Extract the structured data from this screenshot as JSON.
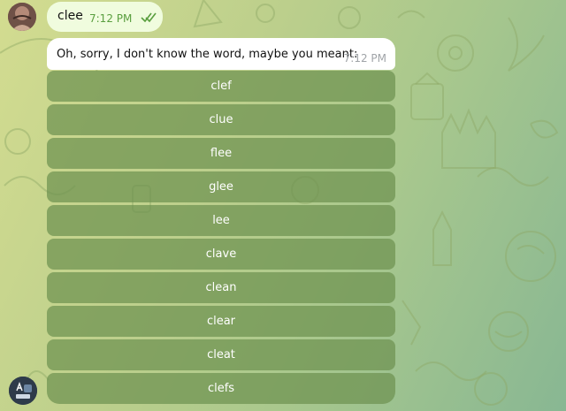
{
  "chat": {
    "outgoing": {
      "text": "clee",
      "time": "7:12 PM",
      "status_icon": "double-check-icon",
      "accent": "#5a9f3f"
    },
    "incoming": {
      "text": "Oh, sorry, I don't know the word, maybe you meant:",
      "time": "7:12 PM"
    },
    "suggestions": [
      "clef",
      "clue",
      "flee",
      "glee",
      "lee",
      "clave",
      "clean",
      "clear",
      "cleat",
      "clefs"
    ]
  },
  "avatars": {
    "user": "user-avatar",
    "bot": "bot-avatar"
  },
  "colors": {
    "background_start": "#d3dc90",
    "background_end": "#88b793",
    "outgoing_bubble": "#f0fcde",
    "incoming_bubble": "#ffffff",
    "keyboard_button": "#6e9150"
  }
}
